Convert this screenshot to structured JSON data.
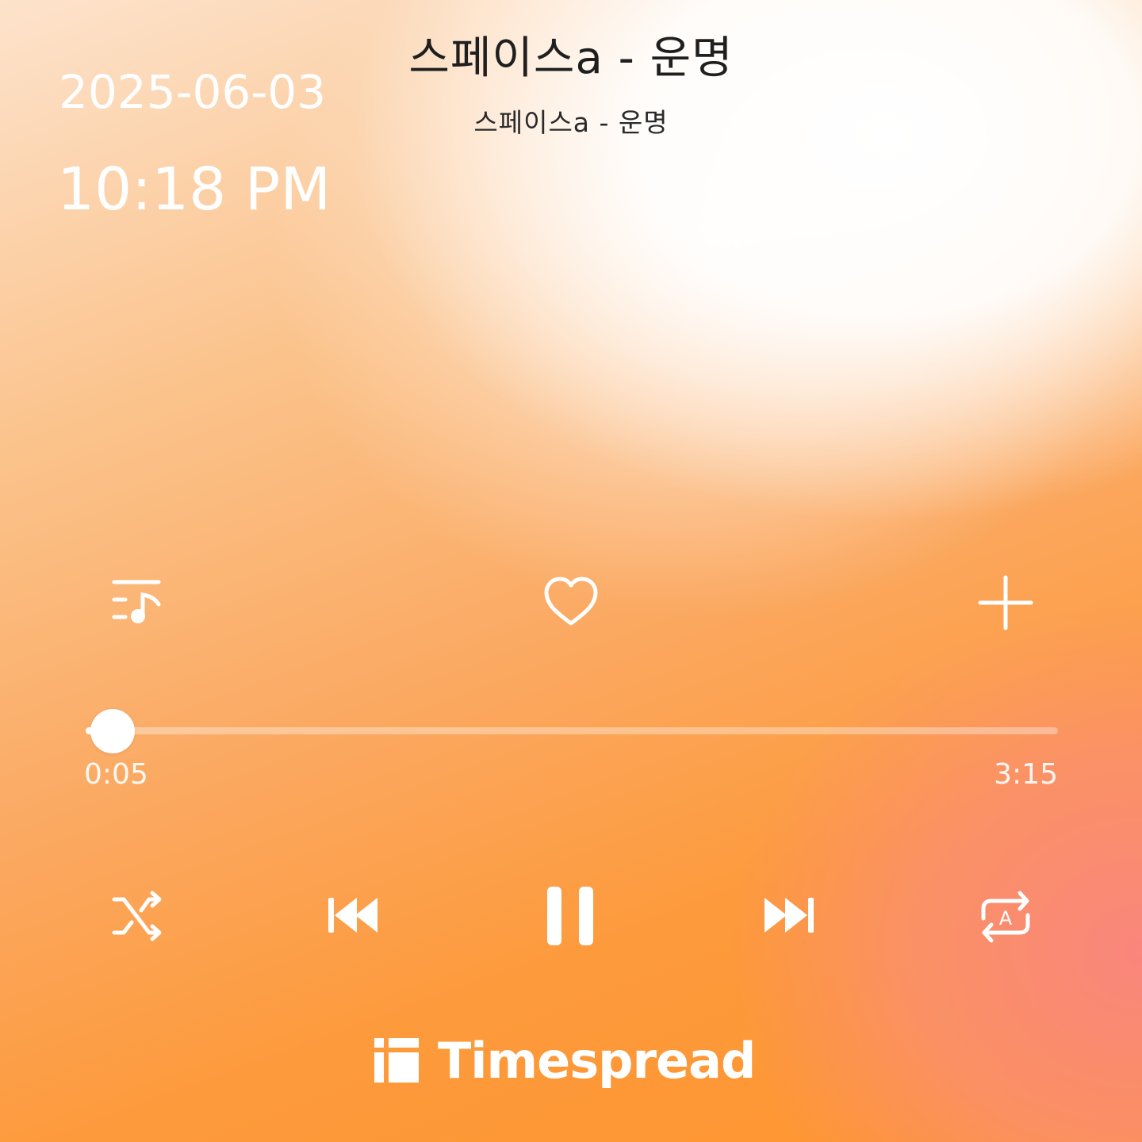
{
  "track": {
    "title": "스페이스a - 운명",
    "subtitle": "스페이스a - 운명"
  },
  "clock": {
    "date": "2025-06-03",
    "time": "10:18 PM"
  },
  "actions": {
    "playlist_icon": "playlist-music-icon",
    "like_icon": "heart-outline-icon",
    "add_icon": "plus-icon"
  },
  "playback": {
    "elapsed": "0:05",
    "total": "3:15",
    "progress_fraction": 0.026,
    "state": "playing"
  },
  "controls": {
    "shuffle_icon": "shuffle-icon",
    "previous_icon": "skip-previous-icon",
    "pause_icon": "pause-icon",
    "next_icon": "skip-next-icon",
    "repeat_icon": "repeat-ab-icon"
  },
  "brand": {
    "name": "Timespread",
    "logo_icon": "timespread-logo-icon"
  },
  "colors": {
    "icon": "#ffffff",
    "title_text": "#1f1f1f",
    "bg_orange": "#fe952f",
    "bg_pink": "#f98a84"
  }
}
